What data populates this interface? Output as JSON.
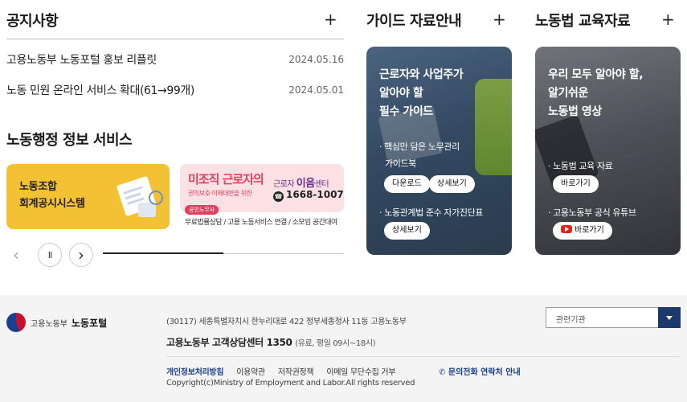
{
  "notices": {
    "title": "공지사항",
    "more": "+",
    "items": [
      {
        "title": "고용노동부 노동포털 홍보 리플릿",
        "date": "2024.05.16"
      },
      {
        "title": "노동 민원 온라인 서비스 확대(61→99개)",
        "date": "2024.05.01"
      }
    ]
  },
  "services": {
    "title": "노동행정 정보 서비스",
    "banner1": {
      "line1": "노동조합",
      "line2": "회계공시시스템"
    },
    "banner2": {
      "title": "미조직 근로자의",
      "center_prefix": "근로자",
      "center_name": "이음",
      "center_suffix": "센터",
      "subtitle": "권익보호·이해대변을 위한",
      "phone": "1668-1007",
      "badge": "공인노무사",
      "caption": "무료법률상담 / 고용 노동서비스 연결 / 소모임 공간대여"
    },
    "controls": {
      "prev": "‹",
      "pause": "II",
      "next": "›"
    },
    "progress": 0.5
  },
  "guide": {
    "title": "가이드 자료안내",
    "more": "+",
    "card": {
      "heading": [
        "근로자와 사업주가",
        "알아야 할",
        "필수 가이드"
      ],
      "item1": {
        "line1": "· 핵심만 담은 노무관리",
        "line2": "가이드북",
        "btn_download": "다운로드",
        "btn_detail": "상세보기"
      },
      "item2": {
        "label": "· 노동관계법 준수 자가진단표",
        "btn_detail": "상세보기"
      }
    }
  },
  "edu": {
    "title": "노동법 교육자료",
    "more": "+",
    "card": {
      "heading": [
        "우리 모두 알아야 할,",
        "알기쉬운",
        "노동법 영상"
      ],
      "item1": {
        "label": "· 노동법 교육 자료",
        "btn": "바로가기"
      },
      "item2": {
        "label": "· 고용노동부 공식 유튜브",
        "btn": "바로가기"
      }
    }
  },
  "footer": {
    "logo_ministry": "고용노동부",
    "logo_portal": "노동포털",
    "address": "(30117) 세종특별자치시 한누리대로 422 정부세종청사 11동 고용노동부",
    "callcenter": "고용노동부 고객상담센터 1350",
    "callcenter_sub": "(유료, 평일 09시~18시)",
    "links": [
      "개인정보처리방침",
      "이용약관",
      "저작권정책",
      "이메일 무단수집 거부"
    ],
    "contact": "문의전화 연락처 안내",
    "copyright": "Copyright(c)Ministry of Employment and Labor.All rights reserved",
    "related_select": "관련기관"
  }
}
